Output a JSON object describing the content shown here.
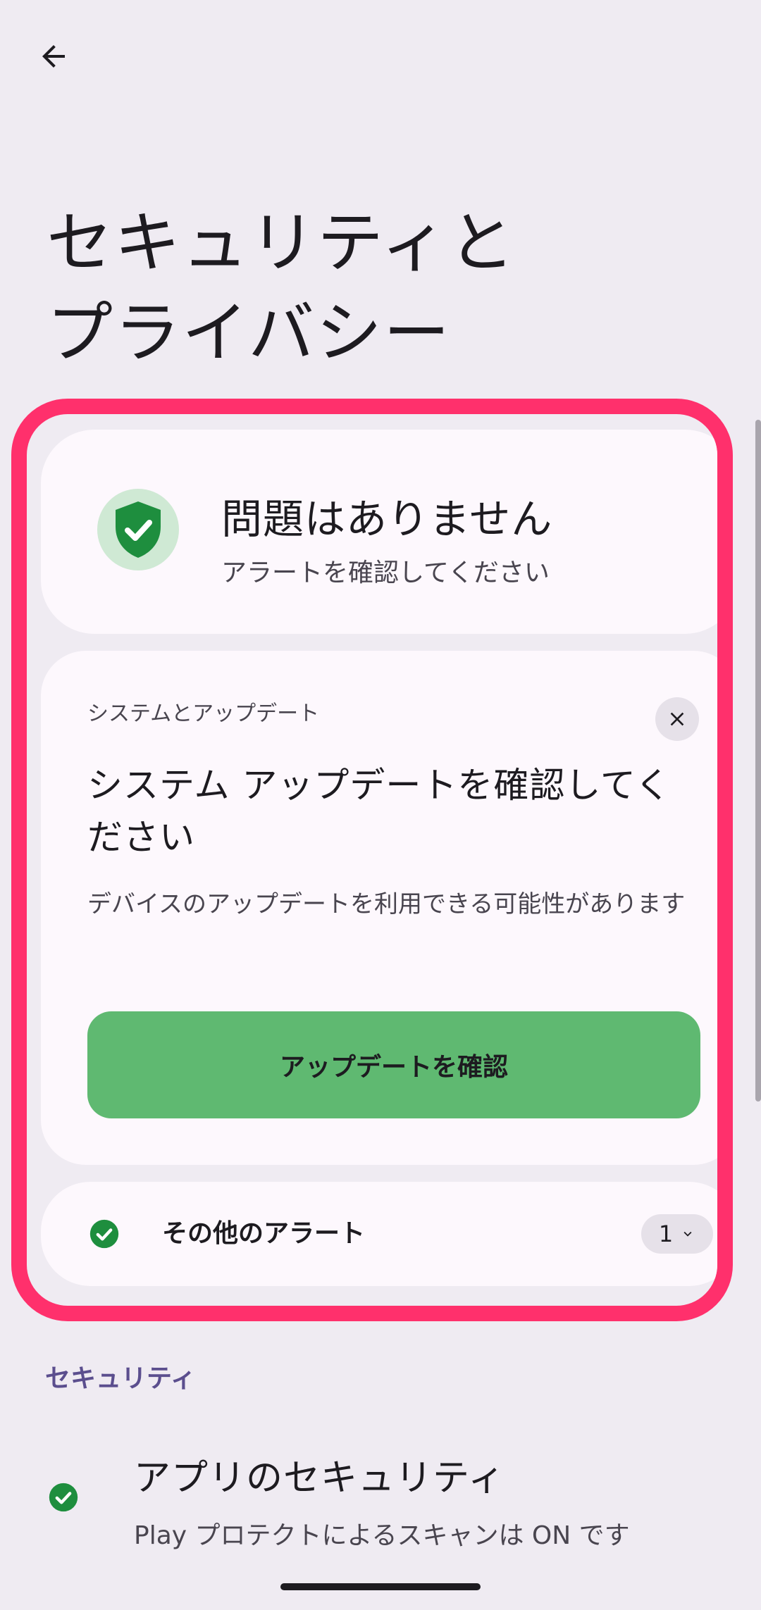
{
  "header": {
    "back_icon": "arrow-left-icon",
    "title": "セキュリティと\nプライバシー"
  },
  "status": {
    "icon": "shield-check-icon",
    "title": "問題はありません",
    "subtitle": "アラートを確認してください"
  },
  "update_card": {
    "category": "システムとアップデート",
    "dismiss_icon": "close-icon",
    "title": "システム アップデートを確認してください",
    "description": "デバイスのアップデートを利用できる可能性があります",
    "button_label": "アップデートを確認"
  },
  "other_alerts": {
    "icon": "check-circle-icon",
    "label": "その他のアラート",
    "count": "1",
    "count_icon": "chevron-down-icon"
  },
  "security_section": {
    "header": "セキュリティ",
    "items": [
      {
        "icon": "check-circle-icon",
        "title": "アプリのセキュリティ",
        "subtitle": "Play プロテクトによるスキャンは ON です"
      }
    ]
  },
  "colors": {
    "background": "#efebf2",
    "card": "#fdf8fd",
    "highlight": "#ff306c",
    "primary_green": "#5fb971",
    "icon_green": "#1e8e3e",
    "section_header": "#5b4e8e"
  }
}
